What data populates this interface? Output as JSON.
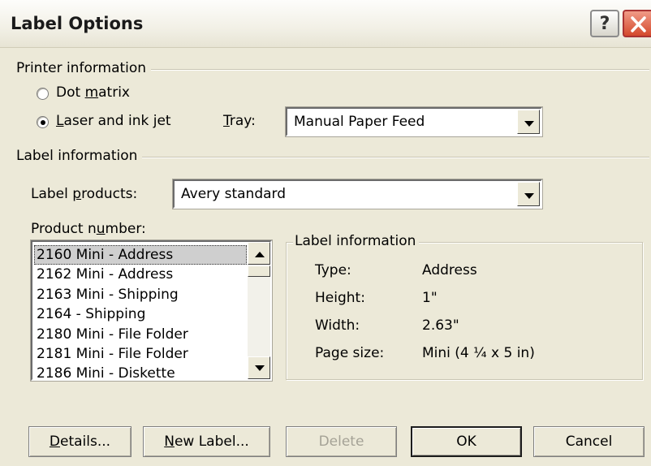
{
  "window": {
    "title": "Label Options",
    "help_glyph": "?",
    "close_glyph": "X"
  },
  "printer_info": {
    "legend": "Printer information",
    "dot_matrix": {
      "pre": "Dot ",
      "key": "m",
      "post": "atrix",
      "checked": false
    },
    "laser": {
      "pre": "",
      "key": "L",
      "post": "aser and ink jet",
      "checked": true
    },
    "tray_label": {
      "pre": "",
      "key": "T",
      "post": "ray:"
    },
    "tray_value": "Manual Paper Feed"
  },
  "label_info_section": {
    "legend": "Label information",
    "products_label": {
      "pre": "Label ",
      "key": "p",
      "post": "roducts:"
    },
    "products_value": "Avery standard",
    "product_number_label": {
      "pre": "Product n",
      "key": "u",
      "post": "mber:"
    },
    "product_numbers": [
      "2160 Mini - Address",
      "2162 Mini - Address",
      "2163 Mini - Shipping",
      "2164 - Shipping",
      "2180 Mini - File Folder",
      "2181 Mini - File Folder",
      "2186 Mini - Diskette"
    ],
    "selected_index": 0
  },
  "details_box": {
    "legend": "Label information",
    "rows": [
      {
        "label": "Type:",
        "value": "Address"
      },
      {
        "label": "Height:",
        "value": "1\""
      },
      {
        "label": "Width:",
        "value": "2.63\""
      },
      {
        "label": "Page size:",
        "value": "Mini (4 ¼ x 5 in)"
      }
    ]
  },
  "buttons": {
    "details": {
      "pre": "",
      "key": "D",
      "post": "etails..."
    },
    "new_label": {
      "pre": "",
      "key": "N",
      "post": "ew Label..."
    },
    "delete": "Delete",
    "ok": "OK",
    "cancel": "Cancel"
  },
  "icons": {
    "help": "help-icon",
    "close": "close-icon",
    "dropdown": "chevron-down-icon",
    "scroll_up": "arrow-up-icon",
    "scroll_down": "arrow-down-icon"
  },
  "colors": {
    "dialog_bg": "#ece9d8",
    "close_button": "#d4492c",
    "selection": "#cfcfcf"
  }
}
